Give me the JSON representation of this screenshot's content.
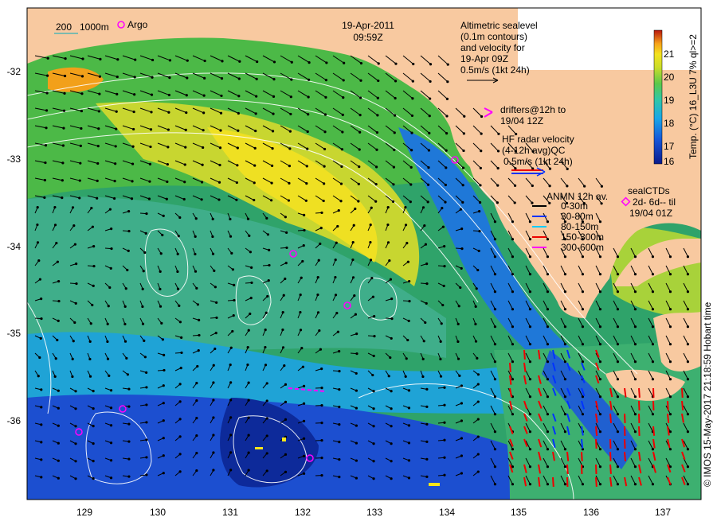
{
  "header": {
    "date": "19-Apr-2011",
    "time": "09:59Z"
  },
  "scale_legend": {
    "label_200": "200",
    "label_1000": "1000m",
    "argo_label": "Argo"
  },
  "altimetry": {
    "lines": [
      "Altimetric sealevel",
      "(0.1m contours)",
      "and velocity for",
      "19-Apr 09Z",
      "0.5m/s (1kt 24h)"
    ]
  },
  "drifters": {
    "lines": [
      "drifters@12h to",
      "19/04 12Z"
    ],
    "color": "#ff00ff"
  },
  "hf_radar": {
    "lines": [
      "HF radar velocity",
      "(4-12h avg)QC",
      "0.5m/s (1kt 24h)"
    ]
  },
  "anmn": {
    "title": "ANMN 12h av.",
    "items": [
      {
        "label": "0-30m",
        "color": "#000000"
      },
      {
        "label": "30-80m",
        "color": "#0033ff"
      },
      {
        "label": "80-150m",
        "color": "#00ccff"
      },
      {
        "label": "150-300m",
        "color": "#ee0000"
      },
      {
        "label": "300-600m",
        "color": "#ff00ff"
      }
    ]
  },
  "sealctds": {
    "lines": [
      "sealCTDs",
      "2d- 6d-- til",
      "19/04 01Z"
    ]
  },
  "colorbar": {
    "label": "Temp. (°C) 16_L3U 7% ql>=2",
    "ticks": [
      "21",
      "20",
      "19",
      "18",
      "17",
      "16"
    ],
    "min": 15.8,
    "max": 21.6
  },
  "credit": "© IMOS 15-May-2017 21:18:59 Hobart time",
  "axes": {
    "x_ticks": [
      "129",
      "130",
      "131",
      "132",
      "133",
      "134",
      "135",
      "136",
      "137"
    ],
    "y_ticks": [
      "-32",
      "-33",
      "-34",
      "-35",
      "-36"
    ],
    "lon_range": [
      128.2,
      137.6
    ],
    "lat_range": [
      -36.9,
      -31.4
    ]
  },
  "colors": {
    "land": "#f8c9a0",
    "contour": "#ffffff",
    "arrow": "#000000"
  }
}
